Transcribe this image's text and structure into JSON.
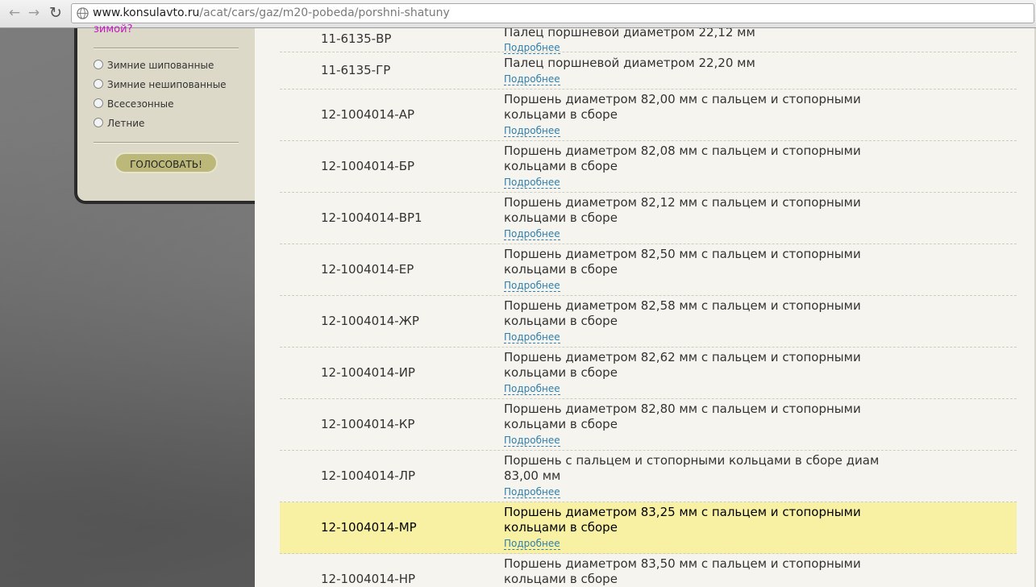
{
  "browser": {
    "url_host": "www.konsulavto.ru",
    "url_path": "/acat/cars/gaz/m20-pobeda/porshni-shatuny"
  },
  "poll": {
    "question": "зимой?",
    "options": [
      "Зимние шипованные",
      "Зимние нешипованные",
      "Всесезонные",
      "Летние"
    ],
    "vote_label": "ГОЛОСОВАТЬ!"
  },
  "parts": {
    "more_label": "Подробнее",
    "rows": [
      {
        "code": "11-6135-ВР",
        "desc": "Палец поршневой диаметром 22,12 мм"
      },
      {
        "code": "11-6135-ГР",
        "desc": "Палец поршневой диаметром 22,20 мм"
      },
      {
        "code": "12-1004014-АР",
        "desc": "Поршень диаметром 82,00 мм с пальцем и стопорными кольцами в сборе"
      },
      {
        "code": "12-1004014-БР",
        "desc": "Поршень диаметром 82,08 мм с пальцем и стопорными кольцами в сборе"
      },
      {
        "code": "12-1004014-ВР1",
        "desc": "Поршень диаметром 82,12 мм с пальцем и стопорными кольцами в сборе"
      },
      {
        "code": "12-1004014-ЕР",
        "desc": "Поршень диаметром 82,50 мм с пальцем и стопорными кольцами в сборе"
      },
      {
        "code": "12-1004014-ЖР",
        "desc": "Поршень диаметром 82,58 мм с пальцем и стопорными кольцами в сборе"
      },
      {
        "code": "12-1004014-ИР",
        "desc": "Поршень диаметром 82,62 мм с пальцем и стопорными кольцами в сборе"
      },
      {
        "code": "12-1004014-КР",
        "desc": "Поршень диаметром 82,80 мм с пальцем и стопорными кольцами в сборе"
      },
      {
        "code": "12-1004014-ЛР",
        "desc": "Поршень с пальцем и стопорными кольцами в сборе диам 83,00 мм"
      },
      {
        "code": "12-1004014-МР",
        "desc": "Поршень диаметром 83,25 мм с пальцем и стопорными кольцами в сборе",
        "highlighted": true
      },
      {
        "code": "12-1004014-НР",
        "desc": "Поршень диаметром 83,50 мм с пальцем и стопорными кольцами в сборе"
      }
    ]
  },
  "colors": {
    "highlight": "#f8f0a2",
    "link": "#2f7fae",
    "poll_question": "#c21dbf"
  }
}
